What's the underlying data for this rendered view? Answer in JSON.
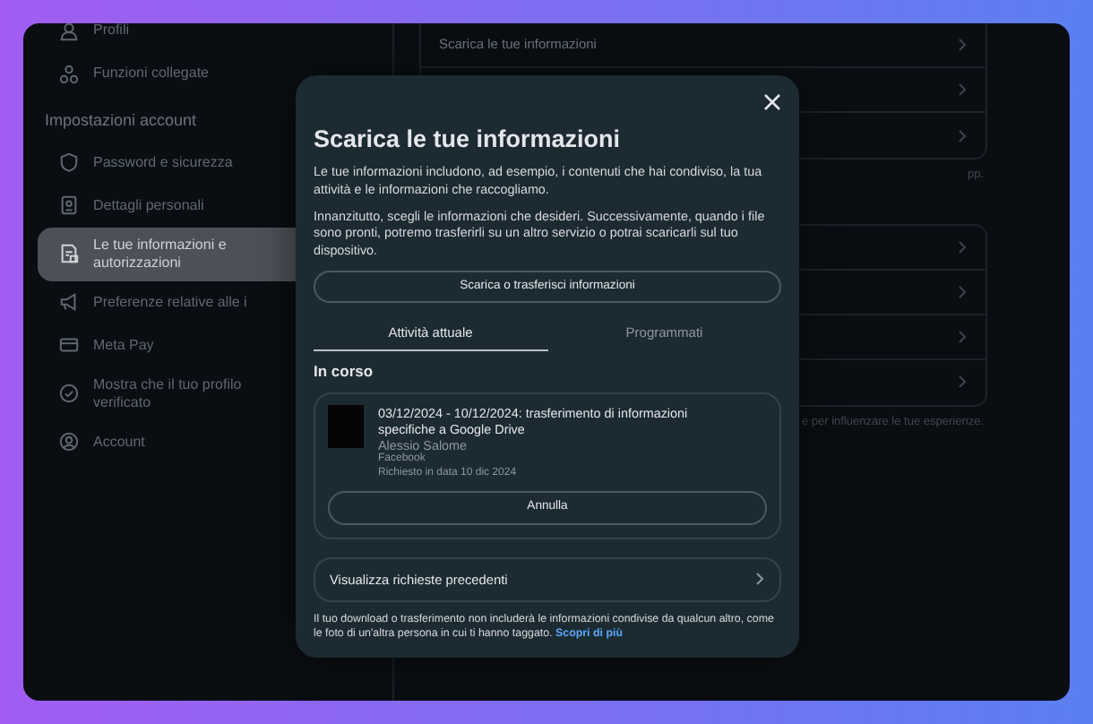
{
  "sidebar": {
    "items": [
      {
        "kind": "item",
        "label_lines": [
          "Profili"
        ],
        "selected": false
      },
      {
        "kind": "item",
        "label_lines": [
          "Funzioni collegate"
        ],
        "selected": false
      },
      {
        "kind": "heading",
        "label_lines": [
          "Impostazioni account"
        ]
      },
      {
        "kind": "item",
        "label_lines": [
          "Password e sicurezza"
        ],
        "selected": false
      },
      {
        "kind": "item",
        "label_lines": [
          "Dettagli personali"
        ],
        "selected": false
      },
      {
        "kind": "item",
        "label_lines": [
          "Le tue informazioni e",
          "autorizzazioni"
        ],
        "selected": true
      },
      {
        "kind": "item",
        "label_lines": [
          "Preferenze relative alle i"
        ],
        "selected": false
      },
      {
        "kind": "item",
        "label_lines": [
          "Meta Pay"
        ],
        "selected": false
      },
      {
        "kind": "item",
        "label_lines": [
          "Mostra che il tuo profilo",
          "verificato"
        ],
        "selected": false
      },
      {
        "kind": "item",
        "label_lines": [
          "Account"
        ],
        "selected": false
      }
    ]
  },
  "content": {
    "groups": [
      {
        "rows": [
          {
            "kind": "labeled",
            "label": "Scarica le tue informazioni"
          },
          {
            "kind": "covered"
          },
          {
            "kind": "covered"
          }
        ],
        "caption": "pp."
      },
      {
        "rows": [
          {
            "kind": "covered"
          },
          {
            "kind": "covered"
          },
          {
            "kind": "covered"
          },
          {
            "kind": "covered"
          }
        ],
        "caption": "e per influenzare le tue esperienze."
      }
    ]
  },
  "dialog": {
    "title": "Scarica le tue informazioni",
    "paragraphs": [
      "Le tue informazioni includono, ad esempio, i contenuti che hai condiviso, la tua attività e le informazioni che raccogliamo.",
      "Innanzitutto, scegli le informazioni che desideri. Successivamente, quando i file sono pronti, potremo trasferirli su un altro servizio o potrai scaricarli sul tuo dispositivo."
    ],
    "primary_button": "Scarica o trasferisci informazioni",
    "tabs": [
      {
        "label": "Attività attuale",
        "selected": true
      },
      {
        "label": "Programmati",
        "selected": false
      }
    ],
    "section_title": "In corso",
    "request": {
      "title": "03/12/2024 - 10/12/2024: trasferimento di informazioni specifiche a Google Drive",
      "name": "Alessio Salome",
      "platform": "Facebook",
      "requested": "Richiesto in data 10 dic 2024",
      "button": "Annulla"
    },
    "history_link": "Visualizza richieste precedenti",
    "footnote": "Il tuo download o trasferimento non includerà le informazioni condivise da qualcun altro, come le foto di un'altra persona in cui ti hanno taggato.",
    "footnote_link": "Scopri di più"
  }
}
